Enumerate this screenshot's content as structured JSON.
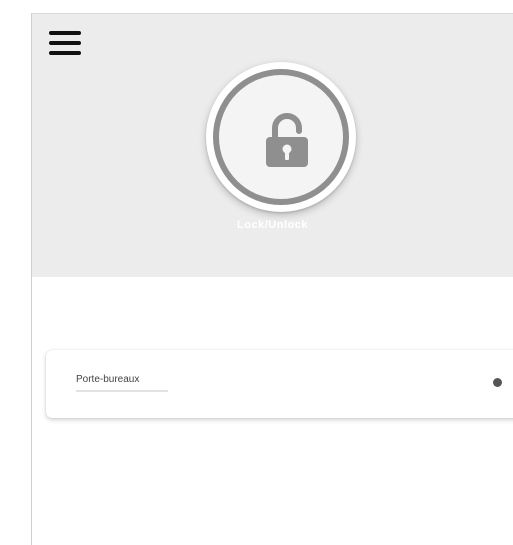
{
  "header": {
    "menu_icon": "hamburger-menu-icon",
    "lock_icon": "unlocked-padlock-icon",
    "status_label": "Lock/Unlock",
    "accent_ring_color": "#8f8f8f",
    "background_color": "#ececec"
  },
  "devices": [
    {
      "name": "Porte-bureaux",
      "status_icon": "status-dot-icon",
      "status_color": "#555555"
    }
  ]
}
